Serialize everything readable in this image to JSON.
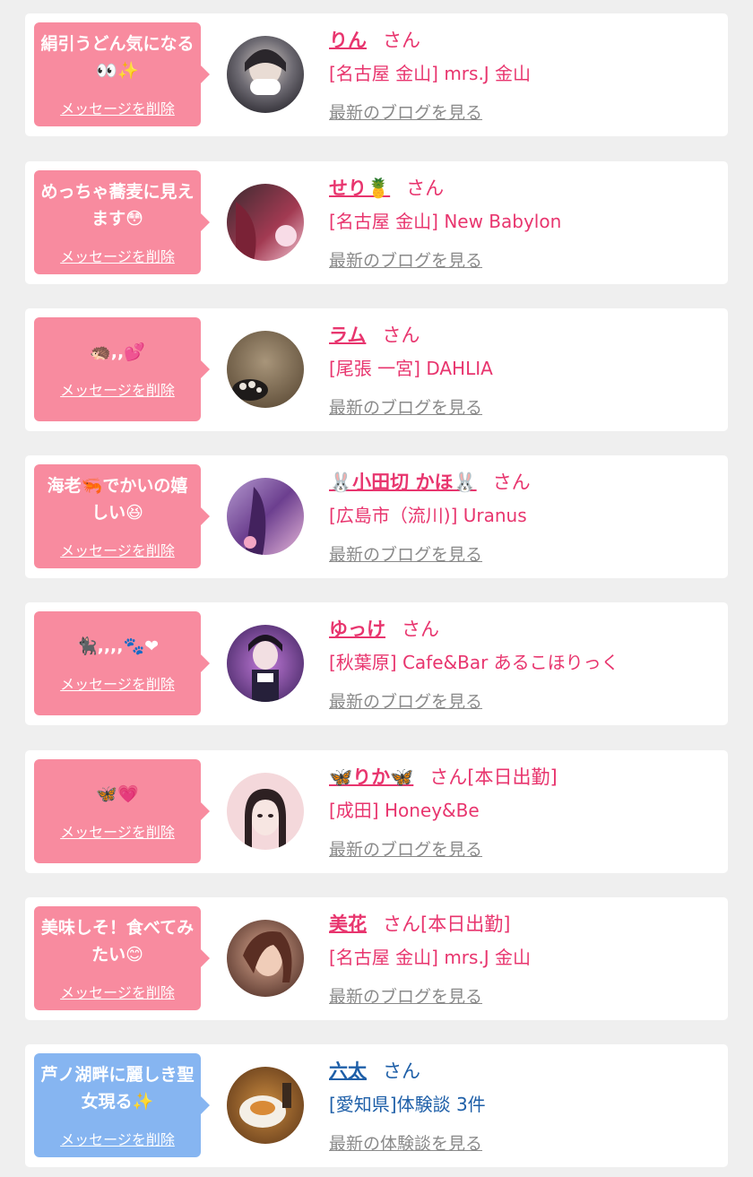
{
  "colors": {
    "bubble_pink": "#f88b9f",
    "bubble_blue": "#86b5f1",
    "name_pink": "#e8356e",
    "name_blue": "#1e5fa8",
    "link_gray": "#8a8a8a",
    "background": "#efefef"
  },
  "entries": [
    {
      "message": "絹引うどん気になる👀✨",
      "delete_label": "メッセージを削除",
      "name": "りん",
      "honorific": "さん",
      "shop": "[名古屋 金山] mrs.J 金山",
      "link": "最新のブログを見る",
      "theme": "pink"
    },
    {
      "message": "めっちゃ蕎麦に見えます😳",
      "delete_label": "メッセージを削除",
      "name": "せり🍍",
      "honorific": "さん",
      "shop": "[名古屋 金山] New Babylon",
      "link": "最新のブログを見る",
      "theme": "pink"
    },
    {
      "message": "🦔,,💕",
      "delete_label": "メッセージを削除",
      "name": "ラム",
      "honorific": "さん",
      "shop": "[尾張 一宮] DAHLIA",
      "link": "最新のブログを見る",
      "theme": "pink"
    },
    {
      "message": "海老🦐でかいの嬉しい😆",
      "delete_label": "メッセージを削除",
      "name": "🐰小田切 かほ🐰",
      "honorific": "さん",
      "shop": "[広島市（流川)] Uranus",
      "link": "最新のブログを見る",
      "theme": "pink"
    },
    {
      "message": "🐈‍⬛,,,,🐾❤",
      "delete_label": "メッセージを削除",
      "name": "ゆっけ",
      "honorific": "さん",
      "shop": "[秋葉原] Cafe&Bar あるこほりっく",
      "link": "最新のブログを見る",
      "theme": "pink"
    },
    {
      "message": "🦋💗",
      "delete_label": "メッセージを削除",
      "name": "🦋りか🦋",
      "honorific": "さん[本日出勤]",
      "shop": "[成田] Honey&Be",
      "link": "最新のブログを見る",
      "theme": "pink"
    },
    {
      "message": "美味しそ！食べてみたい😊",
      "delete_label": "メッセージを削除",
      "name": "美花",
      "honorific": "さん[本日出勤]",
      "shop": "[名古屋 金山] mrs.J 金山",
      "link": "最新のブログを見る",
      "theme": "pink"
    },
    {
      "message": "芦ノ湖畔に麗しき聖女現る✨",
      "delete_label": "メッセージを削除",
      "name": "六太",
      "honorific": "さん",
      "shop": "[愛知県]体験談 3件",
      "link": "最新の体験談を見る",
      "theme": "blue"
    }
  ]
}
